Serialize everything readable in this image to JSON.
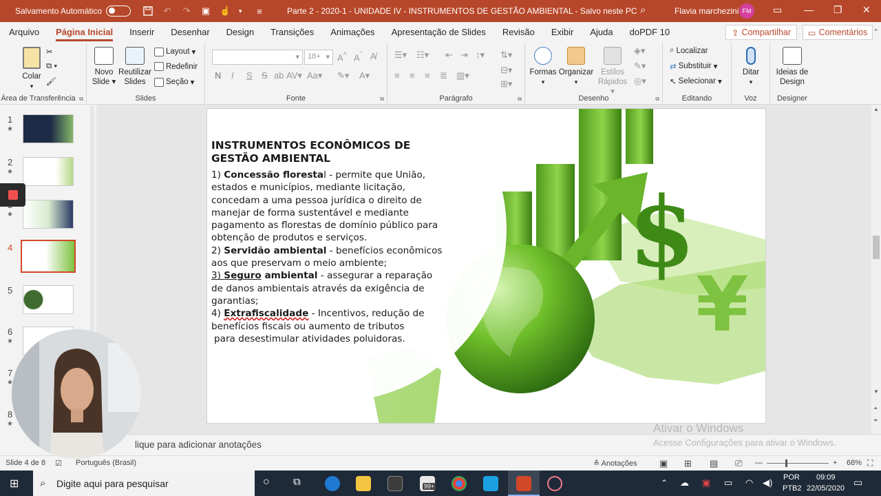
{
  "titlebar": {
    "autosave_label": "Salvamento Automático",
    "document_title": "Parte 2 - 2020-1 - UNIDADE IV - INSTRUMENTOS DE GESTÃO AMBIENTAL  -  Salvo neste PC",
    "user_name": "Flavia marchezini",
    "user_initials": "FM"
  },
  "menu": {
    "tabs": [
      "Arquivo",
      "Página Inicial",
      "Inserir",
      "Desenhar",
      "Design",
      "Transições",
      "Animações",
      "Apresentação de Slides",
      "Revisão",
      "Exibir",
      "Ajuda",
      "doPDF 10"
    ],
    "active_tab": "Página Inicial",
    "share_label": "Compartilhar",
    "comments_label": "Comentários"
  },
  "ribbon": {
    "clipboard": {
      "paste_label": "Colar",
      "group_label": "Área de Transferência"
    },
    "slides": {
      "new_slide_label": "Novo Slide",
      "reuse_label": "Reutilizar Slides",
      "layout_label": "Layout",
      "reset_label": "Redefinir",
      "section_label": "Seção",
      "group_label": "Slides"
    },
    "font": {
      "font_size": "18+",
      "group_label": "Fonte",
      "bold": "N",
      "italic": "I",
      "underline": "S",
      "strike": "S"
    },
    "paragraph": {
      "group_label": "Parágrafo"
    },
    "drawing": {
      "shapes_label": "Formas",
      "arrange_label": "Organizar",
      "quick_styles_label": "Estilos Rápidos",
      "group_label": "Desenho"
    },
    "editing": {
      "find_label": "Localizar",
      "replace_label": "Substituir",
      "select_label": "Selecionar",
      "group_label": "Editando"
    },
    "voice": {
      "dictate_label": "Ditar",
      "group_label": "Voz"
    },
    "designer": {
      "ideas_label": "Ideias de Design",
      "group_label": "Designer"
    }
  },
  "thumbnails": [
    {
      "num": "1",
      "star": "★"
    },
    {
      "num": "2",
      "star": "★"
    },
    {
      "num": "3",
      "star": "★"
    },
    {
      "num": "4",
      "star": "★"
    },
    {
      "num": "5",
      "star": ""
    },
    {
      "num": "6",
      "star": "★"
    },
    {
      "num": "7",
      "star": "★"
    },
    {
      "num": "8",
      "star": "★"
    }
  ],
  "slide": {
    "title": "INSTRUMENTOS ECONÔMICOS DE GESTÃO AMBIENTAL",
    "items": [
      {
        "num": "1) ",
        "key": "Concessão floresta",
        "key_tail": "l",
        "text": " - permite que União, estados e municípios, mediante licitação, concedam a uma pessoa jurídica o direito de manejar de forma sustentável e mediante pagamento as florestas de domínio público para obtenção de produtos e serviços."
      },
      {
        "num": "2) ",
        "key": "Servidão ambiental",
        "text": " - benefícios econômicos aos que preservam o meio ambiente;"
      },
      {
        "num": "3) ",
        "key": "Seguro",
        "key2": " ambiental",
        "text": " - assegurar a reparação de danos ambientais através da exigência de garantias;"
      },
      {
        "num": "4) ",
        "key": "Extrafiscalidade",
        "text": " - Incentivos, redução de benefícios fiscais ou aumento de tributos",
        "text2": " para desestimular atividades poluidoras."
      }
    ]
  },
  "notes_placeholder": "lique para adicionar anotações",
  "watermark": {
    "line1": "Ativar o Windows",
    "line2": "Acesse Configurações para ativar o Windows."
  },
  "status": {
    "slide_count": "Slide 4 de 8",
    "language": "Português (Brasil)",
    "notes_label": "Anotações",
    "zoom": "68%"
  },
  "taskbar": {
    "search_placeholder": "Digite aqui para pesquisar",
    "lang": "POR",
    "layout": "PTB2",
    "time": "09:09",
    "date": "22/05/2020",
    "badge": "99+"
  },
  "colors": {
    "accent": "#b7472a",
    "selection": "#d24726",
    "green": "#6fbf2a"
  }
}
